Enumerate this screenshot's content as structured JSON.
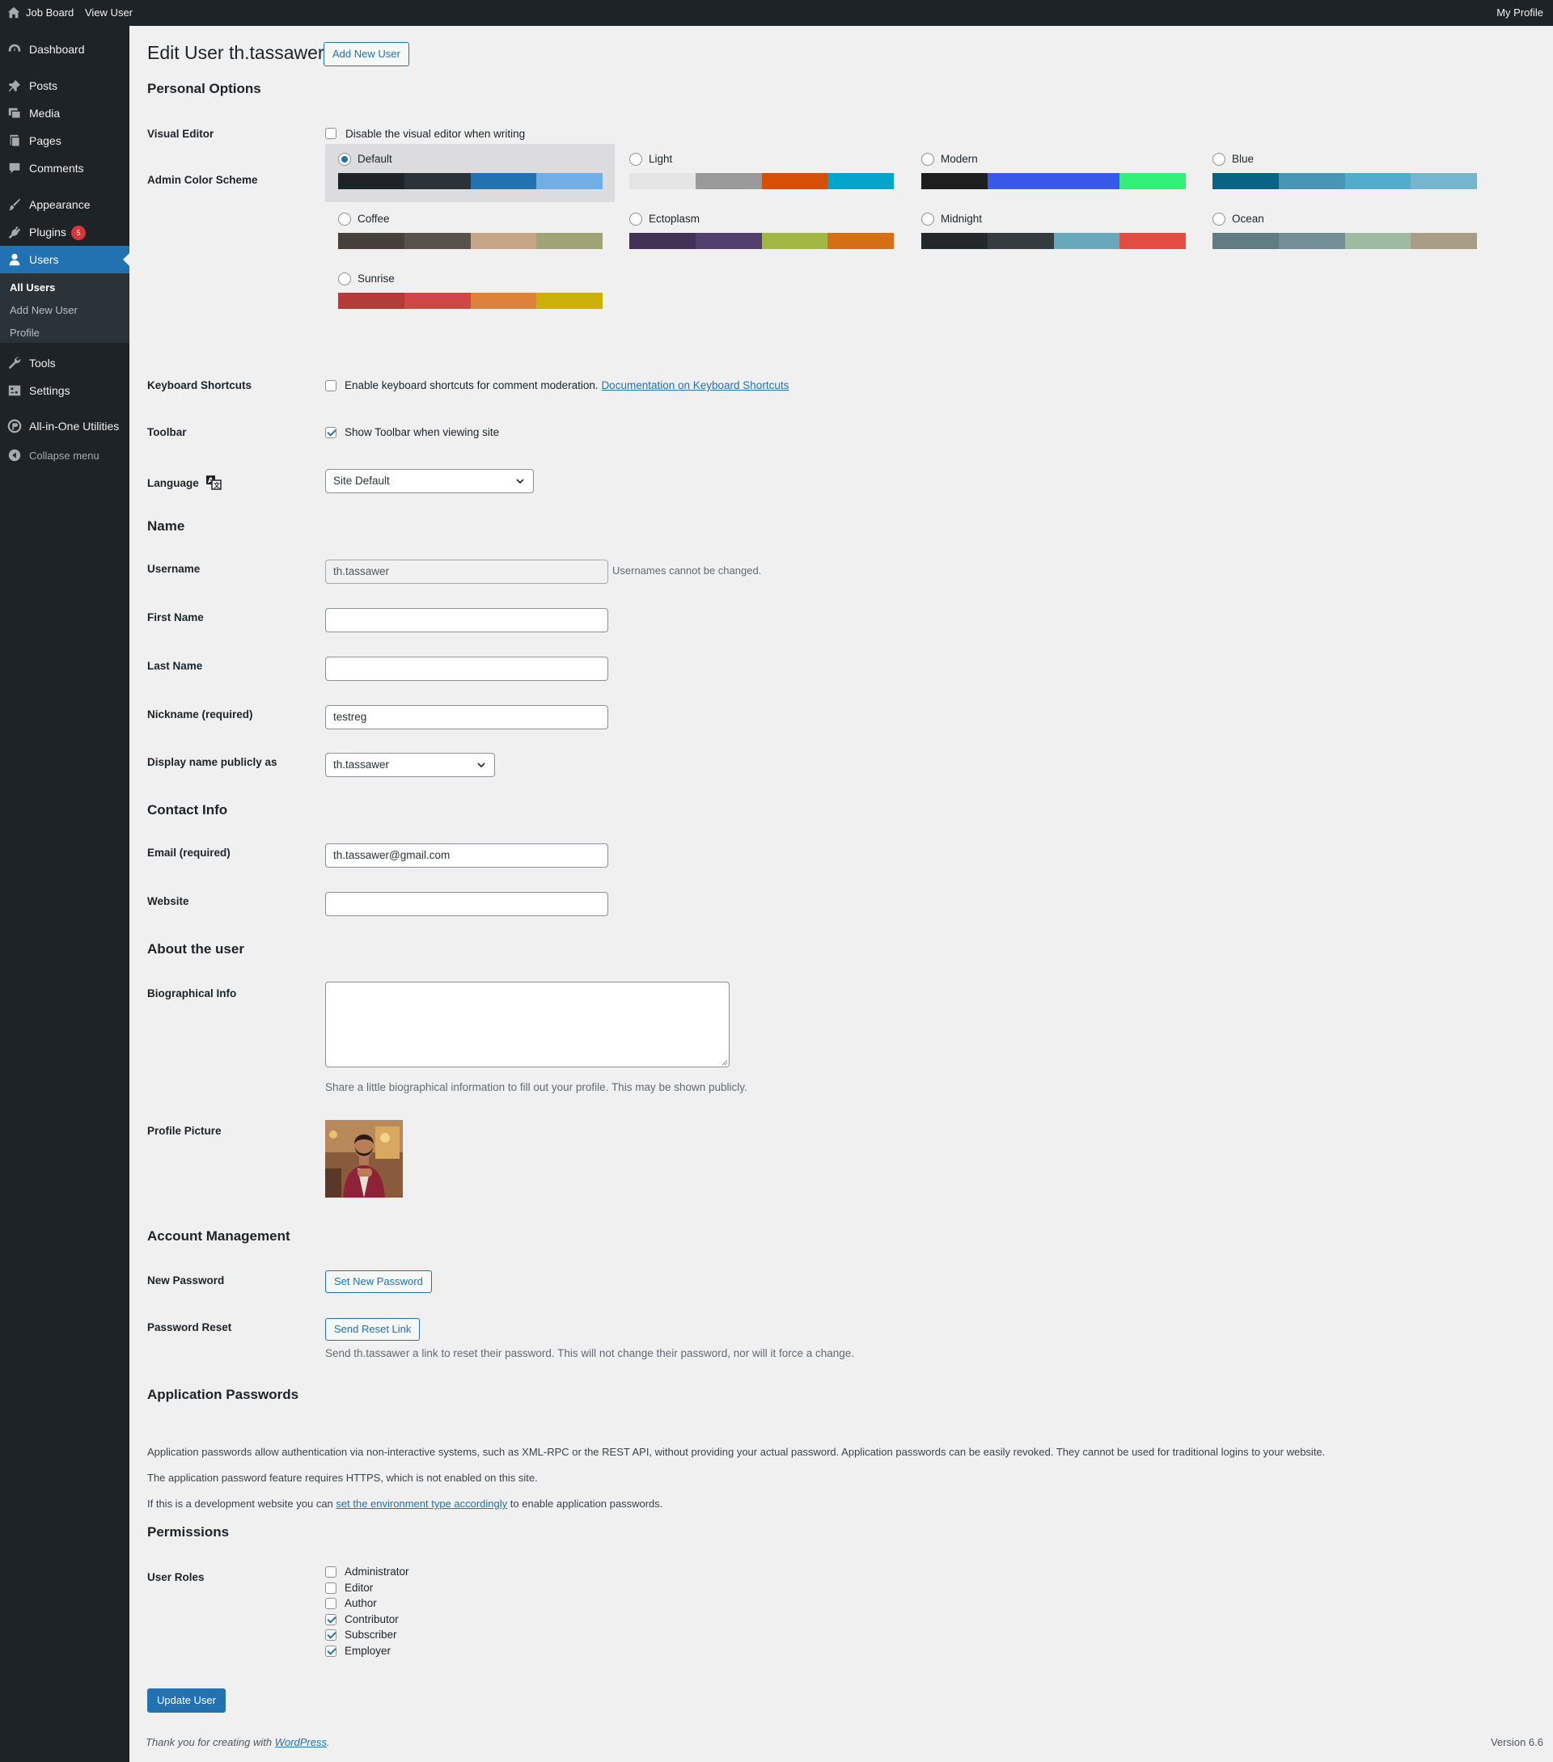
{
  "adminbar": {
    "site_name": "Job Board",
    "view_user": "View User",
    "my_profile": "My Profile"
  },
  "sidebar": {
    "items": [
      {
        "label": "Dashboard",
        "icon": "dashboard-icon"
      },
      {
        "label": "Posts",
        "icon": "pin-icon"
      },
      {
        "label": "Media",
        "icon": "media-icon"
      },
      {
        "label": "Pages",
        "icon": "pages-icon"
      },
      {
        "label": "Comments",
        "icon": "comment-icon"
      },
      {
        "label": "Appearance",
        "icon": "brush-icon"
      },
      {
        "label": "Plugins",
        "icon": "plugin-icon",
        "badge": "5"
      },
      {
        "label": "Users",
        "icon": "user-icon",
        "current": true
      },
      {
        "label": "Tools",
        "icon": "wrench-icon"
      },
      {
        "label": "Settings",
        "icon": "settings-icon"
      },
      {
        "label": "All-in-One Utilities",
        "icon": "utilities-icon"
      }
    ],
    "submenu": [
      "All Users",
      "Add New User",
      "Profile"
    ],
    "collapse": "Collapse menu"
  },
  "page": {
    "title": "Edit User th.tassawer",
    "add_new_button": "Add New User"
  },
  "personal_options": {
    "heading": "Personal Options",
    "visual_editor_label": "Visual Editor",
    "visual_editor_checkbox": "Disable the visual editor when writing",
    "color_scheme_label": "Admin Color Scheme",
    "schemes": [
      {
        "name": "Default",
        "selected": true,
        "colors": [
          "#1d2327",
          "#2c3338",
          "#2271b1",
          "#72aee6"
        ]
      },
      {
        "name": "Light",
        "selected": false,
        "colors": [
          "#e5e5e5",
          "#999999",
          "#d64e07",
          "#04a4cc"
        ]
      },
      {
        "name": "Modern",
        "selected": false,
        "colors": [
          "#1e1e1e",
          "#3858e9",
          "#3858e9",
          "#33f078"
        ]
      },
      {
        "name": "Blue",
        "selected": false,
        "colors": [
          "#096484",
          "#4796b3",
          "#52accc",
          "#74b6ce"
        ]
      },
      {
        "name": "Coffee",
        "selected": false,
        "colors": [
          "#46403c",
          "#59524c",
          "#c7a589",
          "#9ea476"
        ]
      },
      {
        "name": "Ectoplasm",
        "selected": false,
        "colors": [
          "#413256",
          "#523f6d",
          "#a3b745",
          "#d46f15"
        ]
      },
      {
        "name": "Midnight",
        "selected": false,
        "colors": [
          "#25282b",
          "#363b3f",
          "#69a8bb",
          "#e14d43"
        ]
      },
      {
        "name": "Ocean",
        "selected": false,
        "colors": [
          "#627c83",
          "#738e96",
          "#9ebaa0",
          "#aa9d88"
        ]
      },
      {
        "name": "Sunrise",
        "selected": false,
        "colors": [
          "#b43c38",
          "#cf4944",
          "#dd823b",
          "#ccaf0b"
        ]
      }
    ],
    "keyboard_label": "Keyboard Shortcuts",
    "keyboard_checkbox": "Enable keyboard shortcuts for comment moderation.",
    "keyboard_link": "Documentation on Keyboard Shortcuts",
    "toolbar_label": "Toolbar",
    "toolbar_checkbox": "Show Toolbar when viewing site",
    "language_label": "Language",
    "language_value": "Site Default"
  },
  "name_section": {
    "heading": "Name",
    "username_label": "Username",
    "username_value": "th.tassawer",
    "username_note": "Usernames cannot be changed.",
    "first_name_label": "First Name",
    "first_name_value": "",
    "last_name_label": "Last Name",
    "last_name_value": "",
    "nickname_label": "Nickname (required)",
    "nickname_value": "testreg",
    "display_name_label": "Display name publicly as",
    "display_name_value": "th.tassawer"
  },
  "contact": {
    "heading": "Contact Info",
    "email_label": "Email (required)",
    "email_value": "th.tassawer@gmail.com",
    "website_label": "Website",
    "website_value": ""
  },
  "about": {
    "heading": "About the user",
    "bio_label": "Biographical Info",
    "bio_desc": "Share a little biographical information to fill out your profile. This may be shown publicly.",
    "picture_label": "Profile Picture"
  },
  "account": {
    "heading": "Account Management",
    "new_password_label": "New Password",
    "set_password_button": "Set New Password",
    "reset_label": "Password Reset",
    "reset_button": "Send Reset Link",
    "reset_desc": "Send th.tassawer a link to reset their password. This will not change their password, nor will it force a change."
  },
  "app_passwords": {
    "heading": "Application Passwords",
    "p1": "Application passwords allow authentication via non-interactive systems, such as XML-RPC or the REST API, without providing your actual password. Application passwords can be easily revoked. They cannot be used for traditional logins to your website.",
    "p2": "The application password feature requires HTTPS, which is not enabled on this site.",
    "p3_before": "If this is a development website you can",
    "p3_link": "set the environment type accordingly",
    "p3_after": "to enable application passwords."
  },
  "permissions": {
    "heading": "Permissions",
    "roles_label": "User Roles",
    "roles": [
      {
        "name": "Administrator",
        "checked": false
      },
      {
        "name": "Editor",
        "checked": false
      },
      {
        "name": "Author",
        "checked": false
      },
      {
        "name": "Contributor",
        "checked": true
      },
      {
        "name": "Subscriber",
        "checked": true
      },
      {
        "name": "Employer",
        "checked": true
      }
    ]
  },
  "update_button": "Update User",
  "footer": {
    "thanks_before": "Thank you for creating with",
    "thanks_link": "WordPress",
    "thanks_after": ".",
    "version": "Version 6.6"
  }
}
